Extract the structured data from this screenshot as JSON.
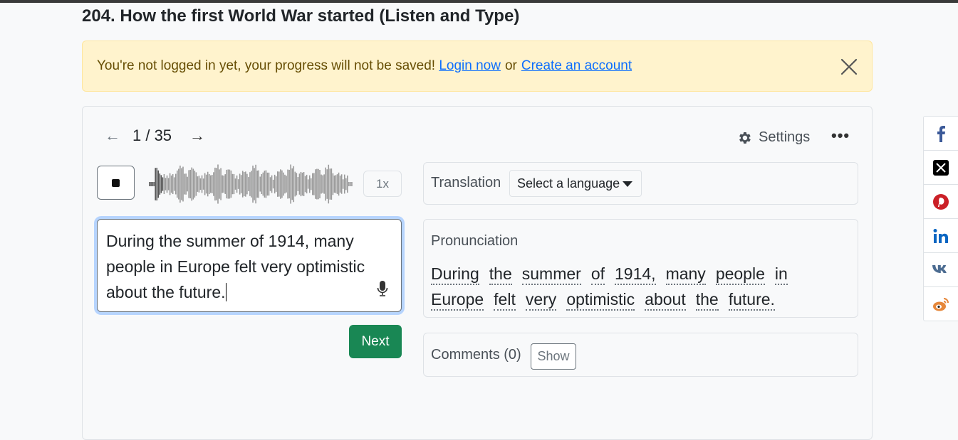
{
  "page": {
    "title": "204. How the first World War started (Listen and Type)"
  },
  "alert": {
    "message": "You're not logged in yet, your progress will not be saved!",
    "login_link": "Login now",
    "or_text": "or",
    "create_link": "Create an account",
    "close_icon": "close-icon"
  },
  "player": {
    "prev_icon": "arrow-left-icon",
    "next_icon": "arrow-right-icon",
    "counter": "1 / 35",
    "settings_label": "Settings",
    "more_label": "•••",
    "speed_label": "1x",
    "playback_progress": 0.07
  },
  "answer": {
    "text": "During the summer of 1914, many people in Europe felt very optimistic about the future.",
    "mic_icon": "microphone-icon"
  },
  "next_button": "Next",
  "translation": {
    "label": "Translation",
    "select_value": "Select a language"
  },
  "pronunciation": {
    "label": "Pronunciation",
    "words": [
      "During",
      "the",
      "summer",
      "of",
      "1914,",
      "many",
      "people",
      "in",
      "Europe",
      "felt",
      "very",
      "optimistic",
      "about",
      "the",
      "future."
    ]
  },
  "comments": {
    "label": "Comments (0)",
    "show_button": "Show"
  },
  "share": [
    {
      "name": "facebook",
      "icon": "facebook-icon",
      "color": "#3b5998"
    },
    {
      "name": "x",
      "icon": "x-icon",
      "color": "#000000"
    },
    {
      "name": "pinterest",
      "icon": "pinterest-icon",
      "color": "#cb2027"
    },
    {
      "name": "linkedin",
      "icon": "linkedin-icon",
      "color": "#0a66c2"
    },
    {
      "name": "vk",
      "icon": "vk-icon",
      "color": "#4c6c91"
    },
    {
      "name": "weibo",
      "icon": "weibo-icon",
      "color": "#e6873a"
    }
  ]
}
